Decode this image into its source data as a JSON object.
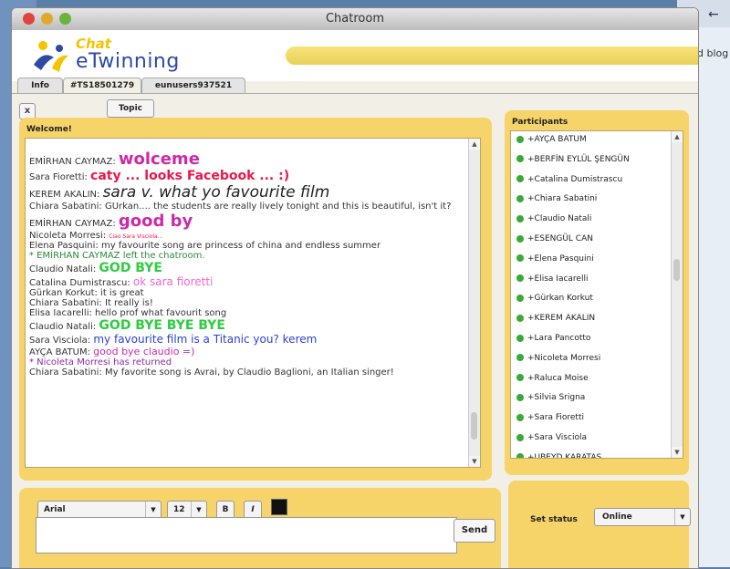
{
  "browser_bg": {
    "nav_glyph": "← ",
    "blog_text": "d blog e"
  },
  "window": {
    "title": "Chatroom"
  },
  "logo": {
    "chat": "Chat",
    "name": "eTwinning"
  },
  "tabs": [
    {
      "label": "Info"
    },
    {
      "label": "#TS18501279"
    },
    {
      "label": "eunusers937521"
    }
  ],
  "toolbar": {
    "close_label": "x",
    "topic_label": "Topic"
  },
  "chat": {
    "title": "Welcome!",
    "messages": [
      {
        "user": "EMİRHAN CAYMAZ: ",
        "text": "wolceme",
        "color": "#cc2aa8",
        "size": 18,
        "bold": true,
        "italic": false
      },
      {
        "user": "Sara Fioretti: ",
        "text": "caty ... looks Facebook ... :)",
        "color": "#e8194a",
        "size": 14,
        "bold": true,
        "italic": false
      },
      {
        "user": "KEREM AKALIN: ",
        "text": "sara v. what yo favourite film",
        "color": "#222222",
        "size": 17,
        "bold": false,
        "italic": true
      },
      {
        "user": "Chiara Sabatini: ",
        "text": "GUrkan.... the students are really lively tonight and this is beautiful, isn't it?",
        "color": "#333333",
        "size": 10,
        "bold": false,
        "italic": false
      },
      {
        "user": "EMİRHAN CAYMAZ: ",
        "text": "good by",
        "color": "#cc2aa8",
        "size": 18,
        "bold": true,
        "italic": false
      },
      {
        "user": "Nicoleta Morresi: ",
        "text": "Ciao Sara Visciola...",
        "color": "#e8194a",
        "size": 6,
        "bold": false,
        "italic": false
      },
      {
        "user": "Elena Pasquini: ",
        "text": "my favourite song are princess of china and endless summer",
        "color": "#333333",
        "size": 10,
        "bold": false,
        "italic": false
      },
      {
        "user": "",
        "text": "* EMİRHAN CAYMAZ left the chatroom.",
        "color": "#2a8a3a",
        "size": 10,
        "bold": false,
        "italic": false
      },
      {
        "user": "Claudio Natali: ",
        "text": "GOD BYE",
        "color": "#2ecc40",
        "size": 14,
        "bold": true,
        "italic": false
      },
      {
        "user": "Catalina Dumistrascu: ",
        "text": "ok sara fioretti",
        "color": "#f066d0",
        "size": 12,
        "bold": false,
        "italic": false
      },
      {
        "user": "Gürkan Korkut: ",
        "text": "it is great",
        "color": "#333333",
        "size": 10,
        "bold": false,
        "italic": false
      },
      {
        "user": "Chiara Sabatini: ",
        "text": "It really is!",
        "color": "#333333",
        "size": 10,
        "bold": false,
        "italic": false
      },
      {
        "user": "Elisa Iacarelli: ",
        "text": "hello prof what favourit song",
        "color": "#333333",
        "size": 10,
        "bold": false,
        "italic": false
      },
      {
        "user": "Claudio Natali: ",
        "text": "GOD BYE BYE BYE",
        "color": "#2ecc40",
        "size": 14,
        "bold": true,
        "italic": false
      },
      {
        "user": "Sara Visciola: ",
        "text": "my favourite film is a Titanic you? kerem",
        "color": "#2b3fd6",
        "size": 12,
        "bold": false,
        "italic": false
      },
      {
        "user": "AYÇA BATUM: ",
        "text": "good bye claudio =)",
        "color": "#cc2aa8",
        "size": 11,
        "bold": false,
        "italic": false
      },
      {
        "user": "",
        "text": "* Nicoleta Morresi has returned",
        "color": "#8a2aa8",
        "size": 10,
        "bold": false,
        "italic": false
      },
      {
        "user": "Chiara Sabatini: ",
        "text": "My favorite song is Avrai, by Claudio Baglioni, an Italian singer!",
        "color": "#333333",
        "size": 10,
        "bold": false,
        "italic": false
      }
    ]
  },
  "participants": {
    "title": "Participants",
    "status_color": "#3aa83a",
    "items": [
      "+AYÇA BATUM",
      "+BERFİN EYLÜL ŞENGÜN",
      "+Catalina Dumistrascu",
      "+Chiara Sabatini",
      "+Claudio Natali",
      "+ESENGÜL CAN",
      "+Elena Pasquini",
      "+Elisa Iacarelli",
      "+Gürkan Korkut",
      "+KEREM AKALIN",
      "+Lara Pancotto",
      "+Nicoleta Morresi",
      "+Raluca Moise",
      "+Silvia  Srigna",
      "+Sara Fioretti",
      "+Sara Visciola",
      "+UBEYD KARATAS"
    ]
  },
  "compose": {
    "font": "Arial",
    "size": "12",
    "bold_label": "B",
    "italic_label": "I",
    "text_color": "#111111",
    "input_value": "",
    "send_label": "Send"
  },
  "status": {
    "label": "Set status",
    "value": "Online"
  }
}
